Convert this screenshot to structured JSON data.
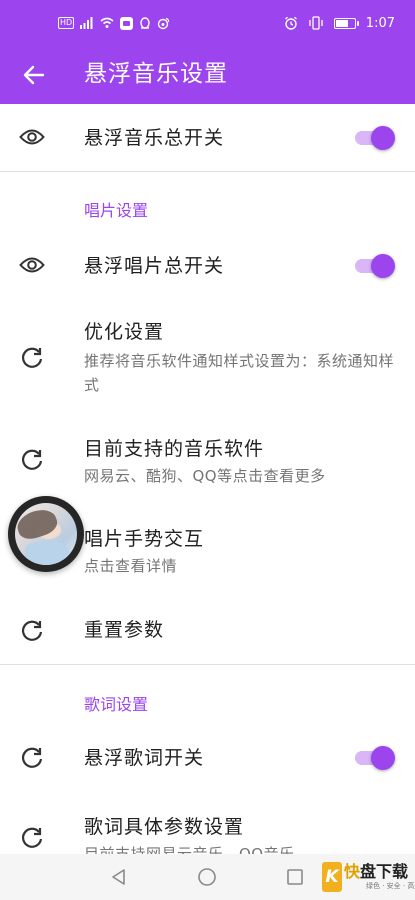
{
  "status_bar": {
    "left_badge": "HD",
    "time": "1:07",
    "icons": [
      "hd-icon",
      "signal-icon",
      "wifi-icon",
      "app-notification-icon",
      "qq-icon",
      "weibo-icon",
      "alarm-icon",
      "vibrate-icon",
      "battery-icon"
    ]
  },
  "app_bar": {
    "title": "悬浮音乐设置",
    "back_icon": "arrow-left-icon"
  },
  "accent_color": "#9c45ee",
  "rows": {
    "master_switch": {
      "title": "悬浮音乐总开关",
      "icon": "eye-icon",
      "switch_on": true
    },
    "disc_section": {
      "header": "唱片设置"
    },
    "disc_master": {
      "title": "悬浮唱片总开关",
      "icon": "eye-icon",
      "switch_on": true
    },
    "optimize": {
      "title": "优化设置",
      "subtitle": "推荐将音乐软件通知样式设置为：系统通知样式",
      "icon": "refresh-icon"
    },
    "supported_apps": {
      "title": "目前支持的音乐软件",
      "subtitle": "网易云、酷狗、QQ等点击查看更多",
      "icon": "refresh-icon"
    },
    "gesture": {
      "title": "唱片手势交互",
      "subtitle": "点击查看详情"
    },
    "reset": {
      "title": "重置参数",
      "icon": "refresh-icon"
    },
    "lyrics_section": {
      "header": "歌词设置"
    },
    "lyrics_switch": {
      "title": "悬浮歌词开关",
      "icon": "refresh-icon",
      "switch_on": true
    },
    "lyrics_params": {
      "title": "歌词具体参数设置",
      "subtitle": "目前支持网易云音乐、QQ音乐",
      "icon": "refresh-icon"
    }
  },
  "nav_bar": {
    "icons": [
      "nav-back-icon",
      "nav-home-icon",
      "nav-recents-icon"
    ]
  },
  "watermark": {
    "letter": "K",
    "name_part1": "快",
    "name_part2": "盘下载",
    "slogan": "绿色 · 安全 · 高速"
  }
}
